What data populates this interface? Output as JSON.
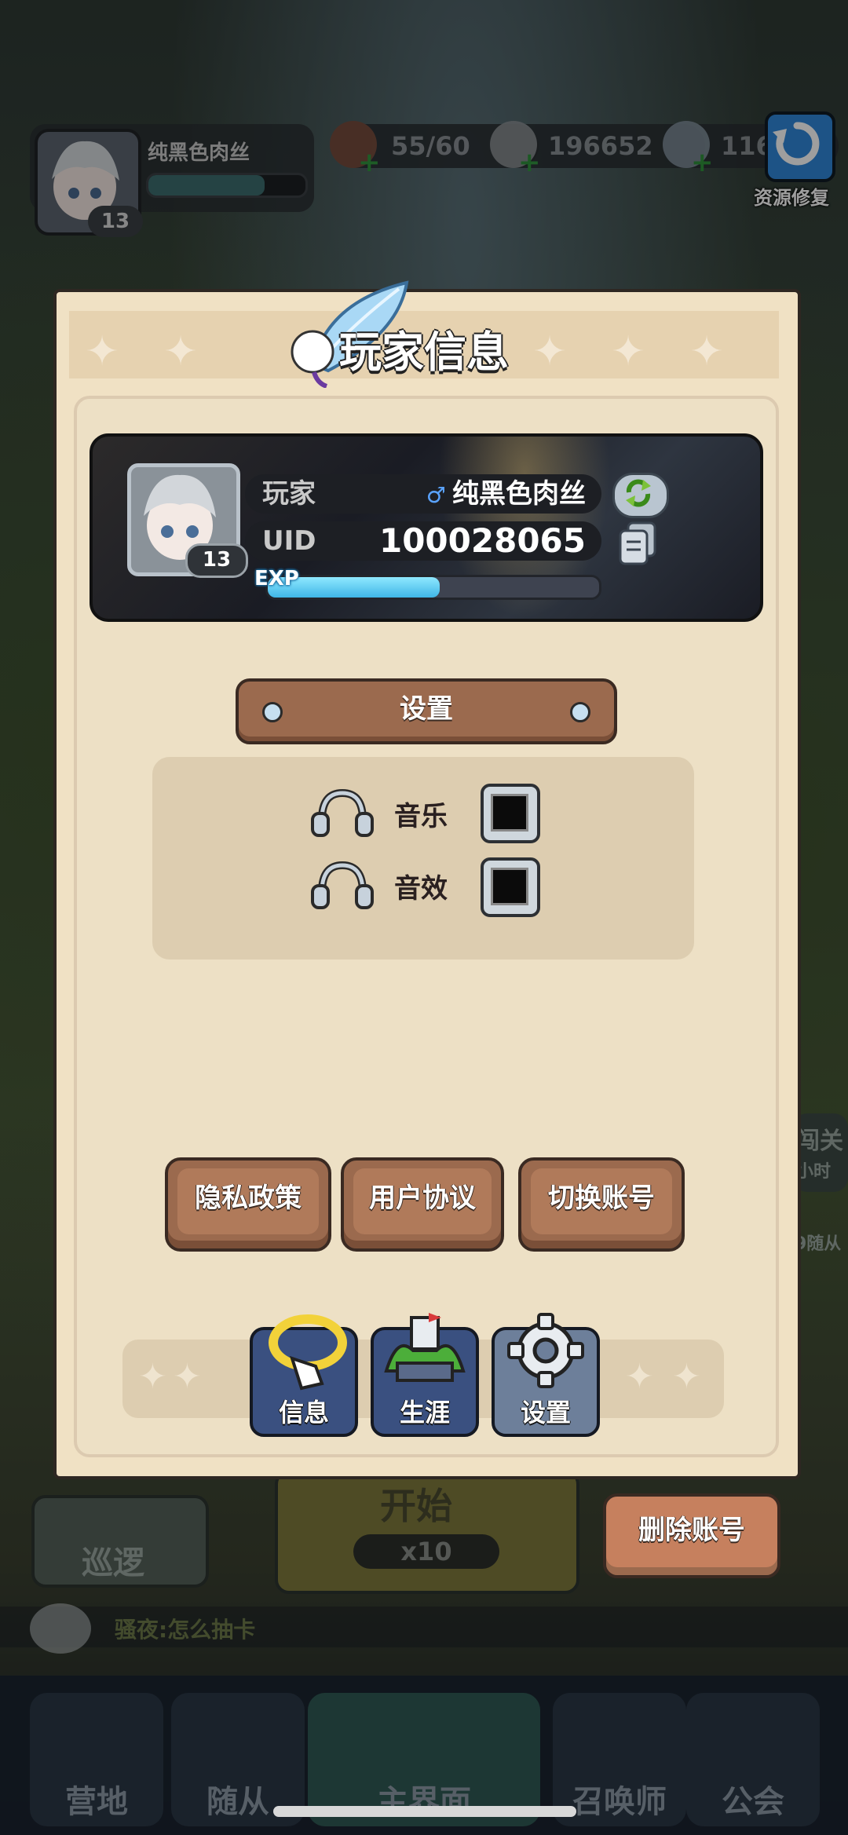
{
  "hud": {
    "player_name": "纯黑色肉丝",
    "level": "13",
    "exp_fraction": 0.74,
    "resources": [
      {
        "name": "meat-icon",
        "value": "55/60"
      },
      {
        "name": "stone-icon",
        "value": "196652"
      },
      {
        "name": "diamond-icon",
        "value": "116"
      }
    ],
    "repair_label": "资源修复"
  },
  "panel": {
    "title": "玩家信息",
    "player_label": "玩家",
    "gender_symbol": "♂",
    "player_name": "纯黑色肉丝",
    "uid_label": "UID",
    "uid_value": "100028065",
    "level": "13",
    "exp_label": "EXP",
    "exp_fraction": 0.52
  },
  "settings": {
    "title": "设置",
    "options": [
      {
        "label": "音乐",
        "checked": true
      },
      {
        "label": "音效",
        "checked": true
      }
    ]
  },
  "actions": {
    "privacy": "隐私政策",
    "agreement": "用户协议",
    "switch_account": "切换账号",
    "delete_account": "删除账号"
  },
  "tabs": [
    {
      "label": "信息",
      "icon": "info-icon",
      "active": false
    },
    {
      "label": "生涯",
      "icon": "career-icon",
      "active": false
    },
    {
      "label": "设置",
      "icon": "gear-icon",
      "active": true
    }
  ],
  "background": {
    "patrol": "巡逻",
    "start": "开始",
    "cost": "x10",
    "level_pass": "闯关",
    "hours": "小时",
    "followers": "9随从",
    "chat": "骚夜:怎么抽卡",
    "nav": [
      "营地",
      "随从",
      "主界面",
      "召唤师",
      "公会"
    ]
  },
  "colors": {
    "panel_bg": "#f0e1c4",
    "button_brown": "#9b6a4e",
    "exp_blue": "#3fb6e6",
    "tab_blue": "#3a5080",
    "repair_blue": "#2f86d8"
  }
}
